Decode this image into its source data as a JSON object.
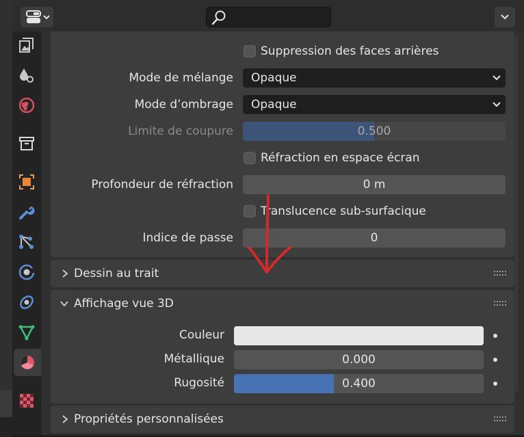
{
  "header": {
    "search_placeholder": ""
  },
  "tabs": [
    {
      "name": "render-tab",
      "icon": "camera-back-icon"
    },
    {
      "name": "output-tab",
      "icon": "drops-icon"
    },
    {
      "name": "world-tab",
      "icon": "globe-icon"
    },
    {
      "name": "collection-tab",
      "icon": "box-icon"
    },
    {
      "name": "object-tab",
      "icon": "square-orange-icon"
    },
    {
      "name": "modifier-tab",
      "icon": "wrench-icon"
    },
    {
      "name": "particles-tab",
      "icon": "nodes-icon"
    },
    {
      "name": "physics-tab",
      "icon": "orbit-icon"
    },
    {
      "name": "constraints-tab",
      "icon": "ring-icon"
    },
    {
      "name": "data-tab",
      "icon": "triangle-icon"
    },
    {
      "name": "material-tab",
      "icon": "material-sphere-icon",
      "active": true
    },
    {
      "name": "texture-tab",
      "icon": "checker-icon"
    }
  ],
  "settings": {
    "backface_culling": {
      "label": "Suppression des faces arrières",
      "checked": false
    },
    "blend_mode": {
      "label": "Mode de mélange",
      "value": "Opaque"
    },
    "shadow_mode": {
      "label": "Mode d’ombrage",
      "value": "Opaque"
    },
    "clip_threshold": {
      "label": "Limite de coupure",
      "value": "0.500",
      "fraction": 0.5,
      "disabled": true
    },
    "screen_refraction": {
      "label": "Réfraction en espace écran",
      "checked": false
    },
    "refraction_depth": {
      "label": "Profondeur de réfraction",
      "value": "0 m"
    },
    "subsurface_translucency": {
      "label": "Translucence sub-surfacique",
      "checked": false
    },
    "pass_index": {
      "label": "Indice de passe",
      "value": "0"
    }
  },
  "panels": {
    "line_art": {
      "title": "Dessin au trait",
      "expanded": false
    },
    "viewport_display": {
      "title": "Affichage vue 3D",
      "expanded": true
    },
    "custom_props": {
      "title": "Propriétés personnalisées",
      "expanded": false
    }
  },
  "viewport": {
    "color": {
      "label": "Couleur",
      "value": "#e8e8e8"
    },
    "metallic": {
      "label": "Métallique",
      "value": "0.000",
      "fraction": 0.0
    },
    "roughness": {
      "label": "Rugosité",
      "value": "0.400",
      "fraction": 0.4
    }
  },
  "colors": {
    "accent_blue": "#4772b3",
    "annotation_red": "#d42a2a"
  }
}
